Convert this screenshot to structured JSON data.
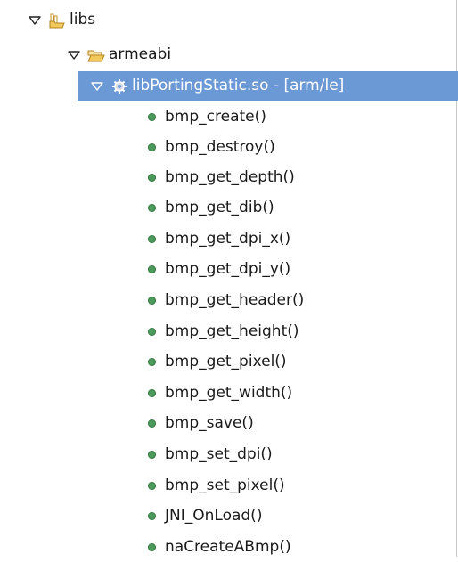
{
  "tree": {
    "root": {
      "label": "libs",
      "icon": "library-folder-icon"
    },
    "folder": {
      "label": "armeabi",
      "icon": "folder-open-icon"
    },
    "binary": {
      "label": "libPortingStatic.so - [arm/le]",
      "icon": "binary-gear-icon",
      "selected": true,
      "selection_color": "#6b99d6"
    },
    "functions": [
      "bmp_create()",
      "bmp_destroy()",
      "bmp_get_depth()",
      "bmp_get_dib()",
      "bmp_get_dpi_x()",
      "bmp_get_dpi_y()",
      "bmp_get_header()",
      "bmp_get_height()",
      "bmp_get_pixel()",
      "bmp_get_width()",
      "bmp_save()",
      "bmp_set_dpi()",
      "bmp_set_pixel()",
      "JNI_OnLoad()",
      "naCreateABmp()"
    ],
    "function_icon": "function-dot-icon",
    "function_color": "#4b9a5b"
  }
}
